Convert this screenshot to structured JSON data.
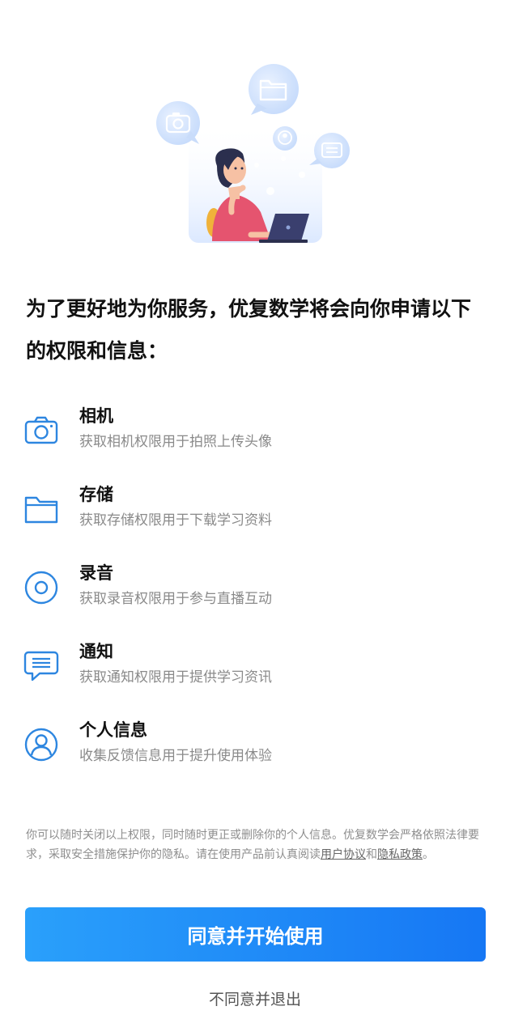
{
  "headline": "为了更好地为你服务，优复数学将会向你申请以下的权限和信息：",
  "permissions": [
    {
      "icon": "camera-icon",
      "title": "相机",
      "desc": "获取相机权限用于拍照上传头像"
    },
    {
      "icon": "folder-icon",
      "title": "存储",
      "desc": "获取存储权限用于下载学习资料"
    },
    {
      "icon": "record-icon",
      "title": "录音",
      "desc": "获取录音权限用于参与直播互动"
    },
    {
      "icon": "message-icon",
      "title": "通知",
      "desc": "获取通知权限用于提供学习资讯"
    },
    {
      "icon": "user-icon",
      "title": "个人信息",
      "desc": "收集反馈信息用于提升使用体验"
    }
  ],
  "notice": {
    "text": "你可以随时关闭以上权限，同时随时更正或删除你的个人信息。优复数学会严格依照法律要求，采取安全措施保护你的隐私。请在使用产品前认真阅读",
    "user_agreement": "用户协议",
    "and": "和",
    "privacy_policy": "隐私政策",
    "end": "。"
  },
  "agree_button": "同意并开始使用",
  "decline_link": "不同意并退出",
  "colors": {
    "accent": "#1677f4",
    "accent_light": "#2aa0fb",
    "icon": "#2d86e0"
  }
}
